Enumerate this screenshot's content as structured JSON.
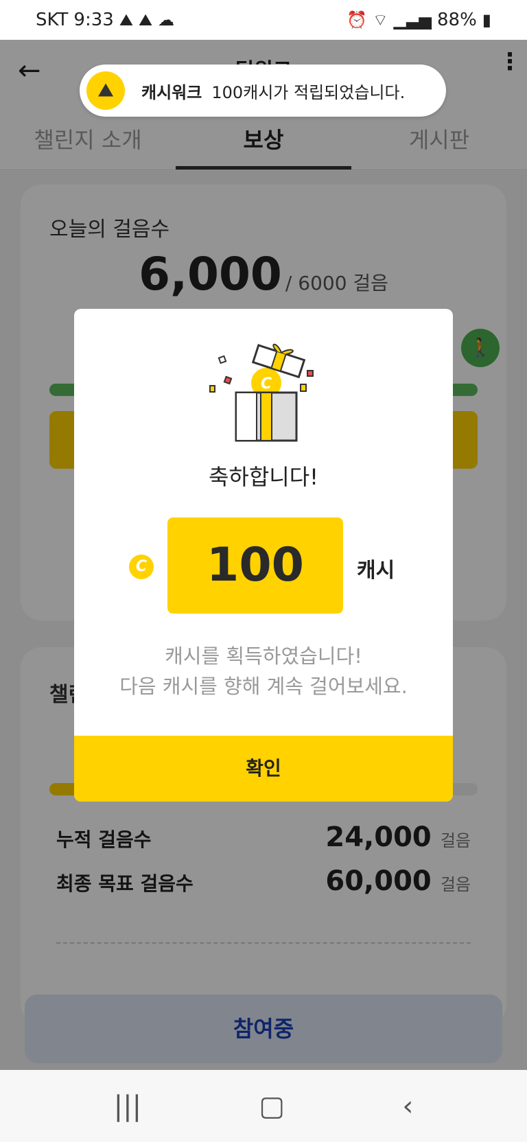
{
  "status_bar": {
    "carrier": "SKT",
    "time": "9:33",
    "battery": "88%"
  },
  "header": {
    "title": "팀워크",
    "tabs": [
      {
        "label": "챌린지 소개"
      },
      {
        "label": "보상"
      },
      {
        "label": "게시판"
      }
    ]
  },
  "today_card": {
    "label": "오늘의 걸음수",
    "steps": "6,000",
    "goal": "/ 6000 걸음"
  },
  "challenge_card": {
    "label": "챌린지 진행률",
    "progress": 0.4,
    "cumulative_label": "누적 걸음수",
    "cumulative_value": "24,000",
    "final_goal_label": "최종 목표 걸음수",
    "final_goal_value": "60,000",
    "unit": "걸음"
  },
  "join_button": "참여중",
  "toast": {
    "app_name": "캐시워크",
    "message": "100캐시가 적립되었습니다."
  },
  "modal": {
    "congrats": "축하합니다!",
    "amount": "100",
    "unit": "캐시",
    "coin_symbol": "C",
    "message_line1": "캐시를 획득하였습니다!",
    "message_line2": "다음 캐시를 향해 계속 걸어보세요.",
    "confirm": "확인"
  },
  "colors": {
    "accent": "#ffd200",
    "progress_green": "#5cb85c",
    "join_text": "#1a3fb3"
  }
}
